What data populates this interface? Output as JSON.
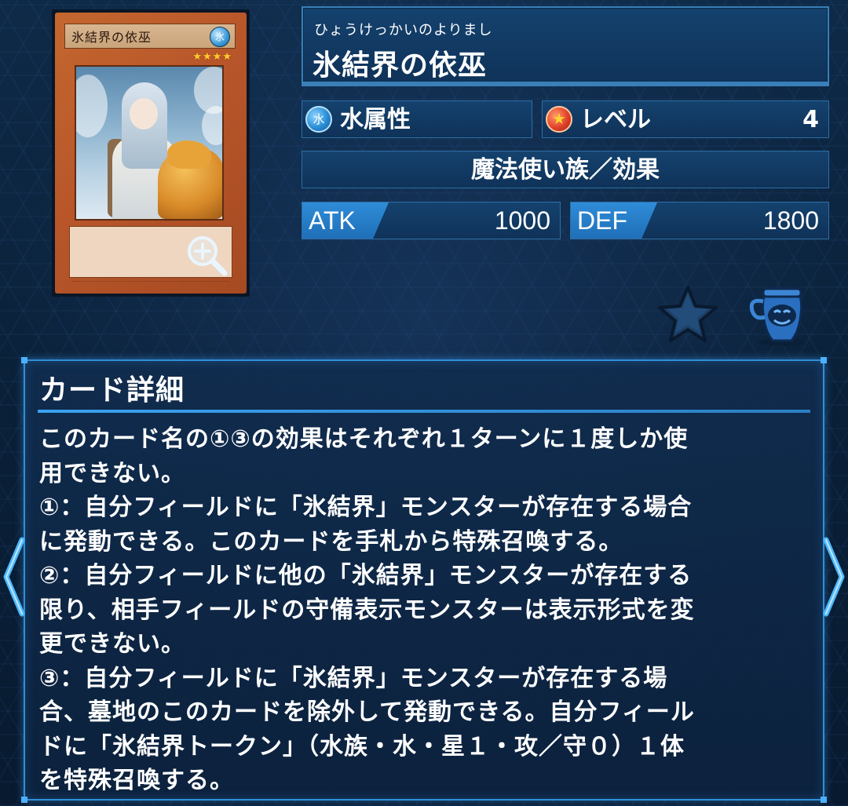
{
  "card": {
    "image_name": "氷結界の依巫",
    "image_attribute_glyph": "氷",
    "image_stars": "★★★★",
    "reading": "ひょうけっかいのよりまし",
    "name": "氷結界の依巫",
    "attribute_glyph": "水",
    "attribute": "水属性",
    "level_label": "レベル",
    "level_glyph": "★",
    "level": "4",
    "type": "魔法使い族／効果",
    "atk_label": "ATK",
    "atk": "1000",
    "def_label": "DEF",
    "def": "1800"
  },
  "details": {
    "title": "カード詳細",
    "effect": "このカード名の①③の効果はそれぞれ１ターンに１度しか使\n用できない。\n①：自分フィールドに「氷結界」モンスターが存在する場合\nに発動できる。このカードを手札から特殊召喚する。\n②：自分フィールドに他の「氷結界」モンスターが存在する\n限り、相手フィールドの守備表示モンスターは表示形式を変\n更できない。\n③：自分フィールドに「氷結界」モンスターが存在する場\n合、墓地のこのカードを除外して発動できる。自分フィール\nドに「氷結界トークン」（水族・水・星１・攻／守０）１体\nを特殊召喚する。"
  },
  "icons": {
    "zoom": "magnifier-plus-icon",
    "favorite": "star-icon",
    "deck": "deck-jar-icon",
    "prev": "chevron-left-icon",
    "next": "chevron-right-icon"
  },
  "colors": {
    "background": "#0a2038",
    "panel": "#14426e",
    "accent": "#2f8fd8",
    "text": "#ffffff"
  }
}
